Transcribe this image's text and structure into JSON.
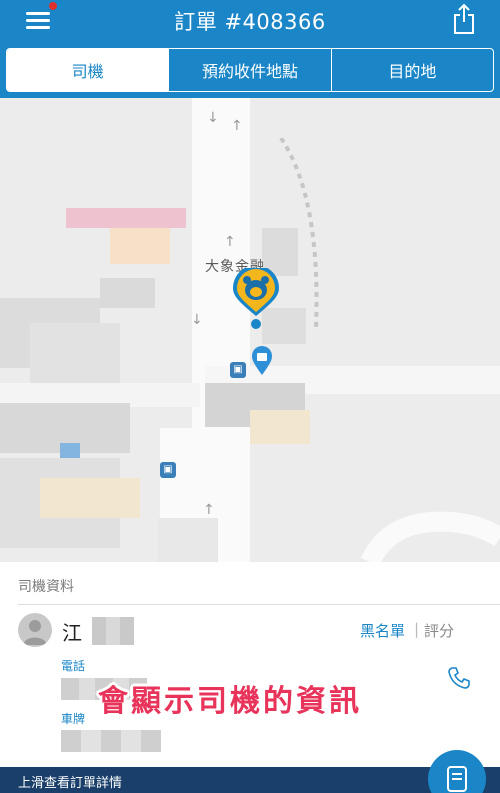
{
  "header": {
    "title": "訂單 #408366",
    "notification_color": "#e0302e",
    "tabs": [
      {
        "label": "司機",
        "active": true
      },
      {
        "label": "預約收件地點",
        "active": false
      },
      {
        "label": "目的地",
        "active": false
      }
    ]
  },
  "map": {
    "poi_label": "大象金融"
  },
  "driver": {
    "section_label": "司機資料",
    "name": "江",
    "blacklist_label": "黑名單",
    "separator": "|",
    "rate_label": "評分",
    "phone_label": "電話",
    "plate_label": "車牌"
  },
  "overlay_caption": "會顯示司機的資訊",
  "footer": {
    "text": "上滑查看訂單詳情"
  },
  "colors": {
    "primary": "#1a86c7",
    "caption": "#e8345a",
    "footer": "#1a3f6a"
  }
}
